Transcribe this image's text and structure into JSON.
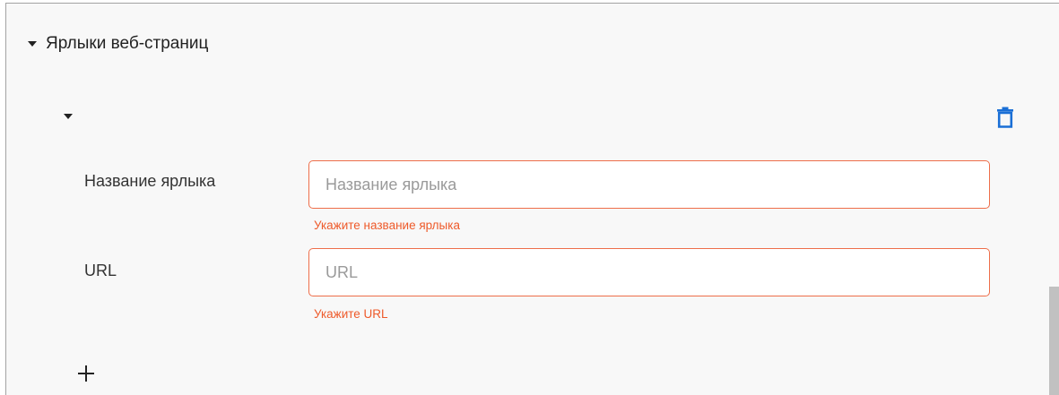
{
  "section": {
    "title": "Ярлыки веб-страниц"
  },
  "fields": {
    "name": {
      "label": "Название ярлыка",
      "value": "",
      "placeholder": "Название ярлыка",
      "error": "Укажите название ярлыка"
    },
    "url": {
      "label": "URL",
      "value": "",
      "placeholder": "URL",
      "error": "Укажите URL"
    }
  },
  "icons": {
    "section_toggle": "caret-down-icon",
    "item_toggle": "caret-down-icon",
    "delete": "trash-icon",
    "add": "plus-icon"
  },
  "colors": {
    "error": "#ee5a2a",
    "input_border_error": "#ee6e4a",
    "accent": "#1a6fd6",
    "panel_background": "#f8f8f8"
  }
}
